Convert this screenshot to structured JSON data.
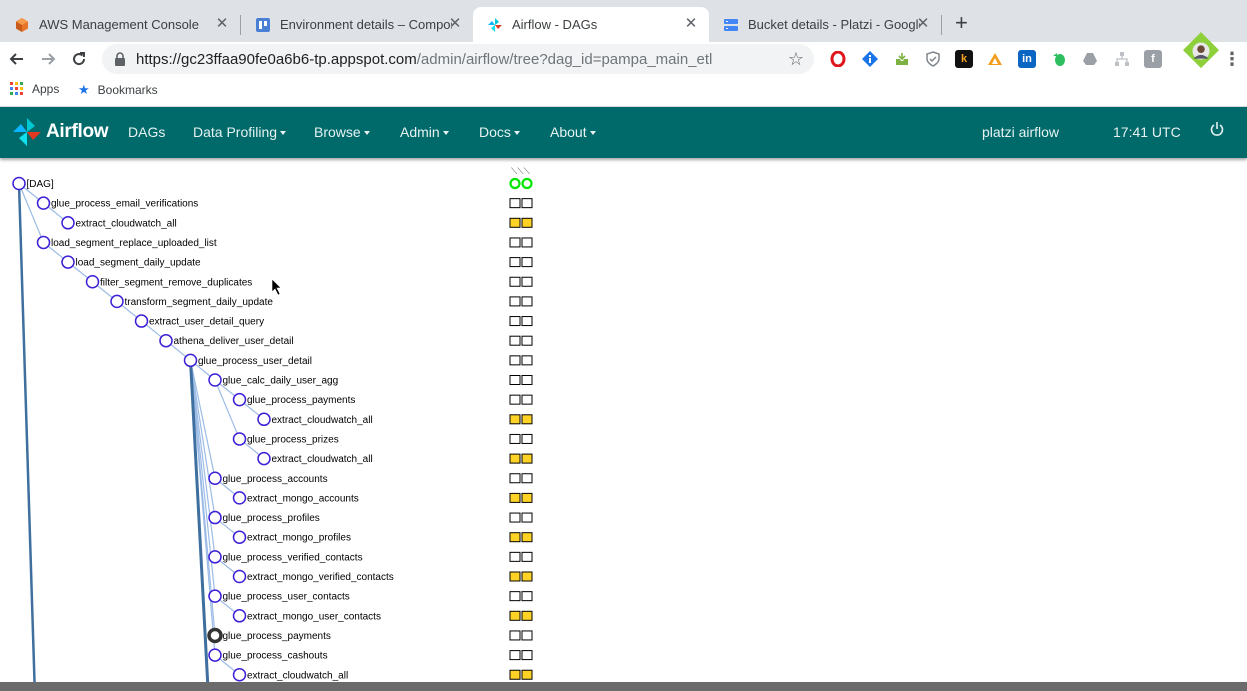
{
  "browser": {
    "tabs": [
      {
        "title": "AWS Management Console",
        "favicon": "aws-cube-icon",
        "active": false
      },
      {
        "title": "Environment details – Compos",
        "favicon": "composer-icon",
        "active": false
      },
      {
        "title": "Airflow - DAGs",
        "favicon": "airflow-pinwheel-icon",
        "active": true
      },
      {
        "title": "Bucket details - Platzi - Google",
        "favicon": "gcs-bucket-icon",
        "active": false
      }
    ],
    "url_host": "https://gc23ffaa90fe0a6b6-tp.appspot.com",
    "url_path": "/admin/airflow/tree?dag_id=pampa_main_etl",
    "bookmarks": [
      {
        "label": "Apps",
        "icon": "apps-grid-icon"
      },
      {
        "label": "Bookmarks",
        "icon": "star-icon"
      }
    ],
    "extensions": [
      "opera-icon",
      "info-icon",
      "inbox-icon",
      "shield-icon",
      "k-icon",
      "triangle-icon",
      "linkedin-icon",
      "evernote-icon",
      "drive-icon",
      "sitemap-icon",
      "facebook-icon",
      "profile-avatar-icon"
    ],
    "extension_letters": {
      "k-icon": "k",
      "linkedin-icon": "in",
      "facebook-icon": "f"
    }
  },
  "navbar": {
    "brand": "Airflow",
    "items": [
      {
        "label": "DAGs",
        "dropdown": false
      },
      {
        "label": "Data Profiling",
        "dropdown": true
      },
      {
        "label": "Browse",
        "dropdown": true
      },
      {
        "label": "Admin",
        "dropdown": true
      },
      {
        "label": "Docs",
        "dropdown": true
      },
      {
        "label": "About",
        "dropdown": true
      }
    ],
    "user": "platzi airflow",
    "time": "17:41 UTC",
    "logout_icon": "power-icon"
  },
  "colors": {
    "navbar": "#00696a",
    "node_stroke": "#3c1fd6",
    "edge": "#9bbbe6",
    "edge_dark": "#3f6f9f",
    "upstream_failed": "#ffd326",
    "success_circle": "#00e600",
    "running_node": "#333333"
  },
  "tree": {
    "run_header_marks": "⟍⟍⟍",
    "nodes": [
      {
        "label": "[DAG]",
        "depth": 0,
        "status": "dag"
      },
      {
        "label": "glue_process_email_verifications",
        "depth": 1,
        "status": "none"
      },
      {
        "label": "extract_cloudwatch_all",
        "depth": 2,
        "status": "upstream_failed"
      },
      {
        "label": "load_segment_replace_uploaded_list",
        "depth": 1,
        "status": "none"
      },
      {
        "label": "load_segment_daily_update",
        "depth": 2,
        "status": "none"
      },
      {
        "label": "filter_segment_remove_duplicates",
        "depth": 3,
        "status": "none"
      },
      {
        "label": "transform_segment_daily_update",
        "depth": 4,
        "status": "none"
      },
      {
        "label": "extract_user_detail_query",
        "depth": 5,
        "status": "none"
      },
      {
        "label": "athena_deliver_user_detail",
        "depth": 6,
        "status": "none"
      },
      {
        "label": "glue_process_user_detail",
        "depth": 7,
        "status": "none"
      },
      {
        "label": "glue_calc_daily_user_agg",
        "depth": 8,
        "status": "none"
      },
      {
        "label": "glue_process_payments",
        "depth": 9,
        "status": "none"
      },
      {
        "label": "extract_cloudwatch_all",
        "depth": 10,
        "status": "upstream_failed"
      },
      {
        "label": "glue_process_prizes",
        "depth": 9,
        "status": "none"
      },
      {
        "label": "extract_cloudwatch_all",
        "depth": 10,
        "status": "upstream_failed"
      },
      {
        "label": "glue_process_accounts",
        "depth": 8,
        "status": "none"
      },
      {
        "label": "extract_mongo_accounts",
        "depth": 9,
        "status": "upstream_failed"
      },
      {
        "label": "glue_process_profiles",
        "depth": 8,
        "status": "none"
      },
      {
        "label": "extract_mongo_profiles",
        "depth": 9,
        "status": "upstream_failed"
      },
      {
        "label": "glue_process_verified_contacts",
        "depth": 8,
        "status": "none"
      },
      {
        "label": "extract_mongo_verified_contacts",
        "depth": 9,
        "status": "upstream_failed"
      },
      {
        "label": "glue_process_user_contacts",
        "depth": 8,
        "status": "none"
      },
      {
        "label": "extract_mongo_user_contacts",
        "depth": 9,
        "status": "upstream_failed"
      },
      {
        "label": "glue_process_payments",
        "depth": 8,
        "status": "none",
        "highlight": true
      },
      {
        "label": "glue_process_cashouts",
        "depth": 8,
        "status": "none"
      },
      {
        "label": "extract_cloudwatch_all",
        "depth": 9,
        "status": "upstream_failed"
      }
    ]
  }
}
